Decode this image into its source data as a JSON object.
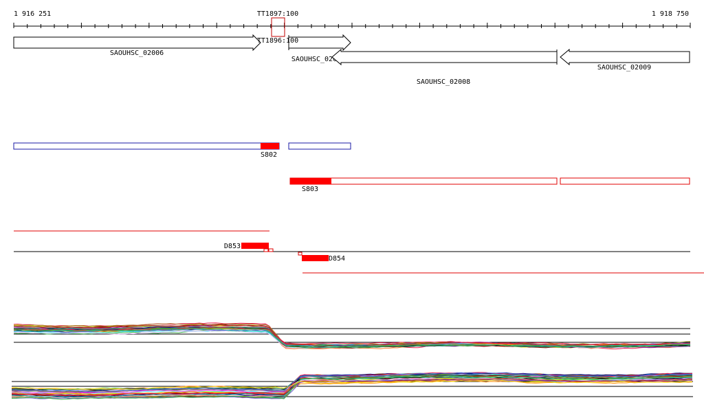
{
  "coordinates": {
    "start_label": "1 916 251",
    "end_label": "1 918 750"
  },
  "terminators": [
    {
      "label": "TT1897:100"
    },
    {
      "label": "TT1896:100"
    }
  ],
  "genes": [
    {
      "label": "SAOUHSC_02006",
      "strand": "+"
    },
    {
      "label": "SAOUHSC_02007",
      "strand": "+"
    },
    {
      "label": "SAOUHSC_02008",
      "strand": "-"
    },
    {
      "label": "SAOUHSC_02009",
      "strand": "-"
    }
  ],
  "segments": [
    {
      "label": "S802"
    },
    {
      "label": "S803"
    }
  ],
  "downshifts": [
    {
      "label": "D853"
    },
    {
      "label": "D854"
    }
  ],
  "colors": {
    "gene_outline": "#000000",
    "segment_forward": "#1a1aa6",
    "segment_reverse": "#e00000",
    "highlight_fill": "#ff0000",
    "axis": "#000000",
    "terminator_box": "#c00000"
  }
}
